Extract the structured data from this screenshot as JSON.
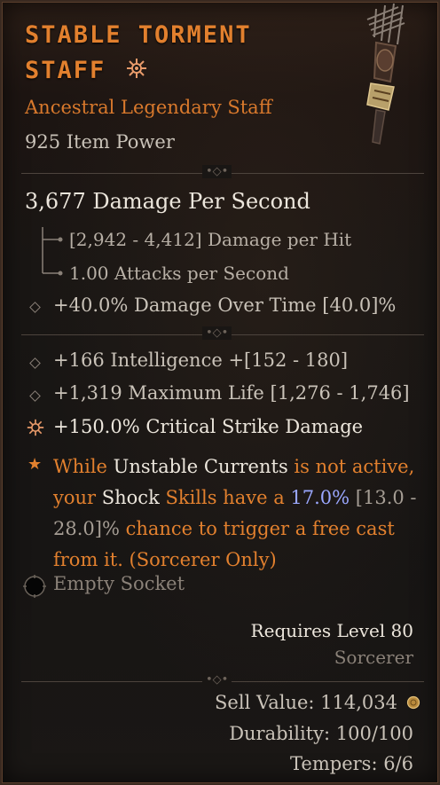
{
  "item": {
    "name_line1": "STABLE TORMENT",
    "name_line2": "STAFF",
    "type": "Ancestral Legendary Staff",
    "item_power": "925 Item Power"
  },
  "weapon": {
    "dps": "3,677 Damage Per Second",
    "damage_per_hit": "[2,942 - 4,412] Damage per Hit",
    "attacks_per_second": "1.00 Attacks per Second"
  },
  "implicit": {
    "dot": "+40.0% Damage Over Time [40.0]%"
  },
  "affixes": {
    "intelligence": "+166 Intelligence +[152 - 180]",
    "max_life": "+1,319 Maximum Life [1,276 - 1,746]",
    "crit_damage": "+150.0% Critical Strike Damage"
  },
  "legendary": {
    "t1": "While",
    "t2": " Unstable Currents",
    "t3": " is not active,",
    "t4": "your",
    "t5": " Shock",
    "t6": " Skills have a",
    "t7": " 17.0%",
    "t8": " [13.0 -",
    "t9": "28.0]%",
    "t10": " chance to trigger a free cast",
    "t11": "from it. (Sorcerer Only)"
  },
  "socket": "Empty Socket",
  "requirements": {
    "level": "Requires Level 80",
    "class": "Sorcerer"
  },
  "footer": {
    "sell_value": "Sell Value: 114,034",
    "durability": "Durability: 100/100",
    "tempers": "Tempers: 6/6"
  },
  "colors": {
    "legendary_orange": "#e2802e",
    "value_blue": "#9aa7ff",
    "text_light": "#ece6dc",
    "text_grey": "#c9c2b8"
  },
  "icons": [
    "crit-damage-icon",
    "legendary-star-icon",
    "socket-icon",
    "gold-coin-icon",
    "staff-image",
    "diamond-bullet-icon"
  ]
}
